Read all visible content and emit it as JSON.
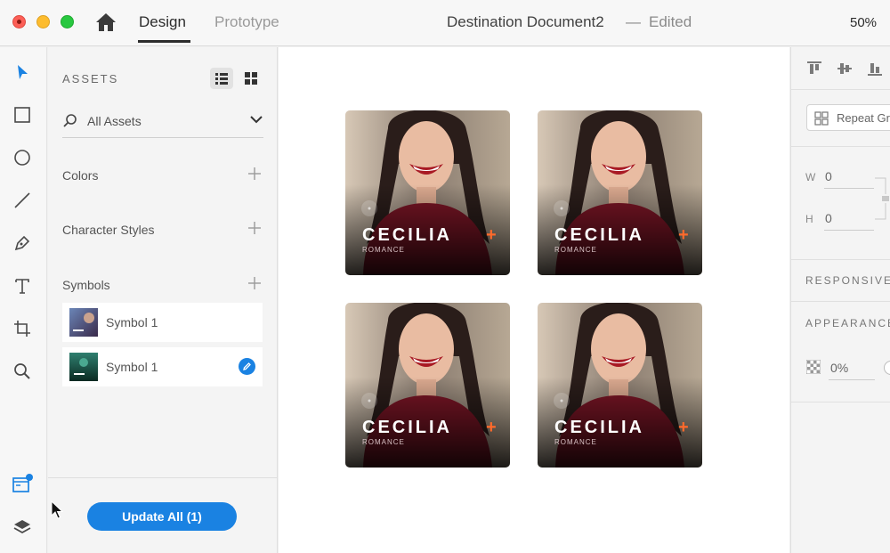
{
  "titlebar": {
    "tab_design": "Design",
    "tab_prototype": "Prototype",
    "document_title": "Destination Document2",
    "separator": "—",
    "document_status": "Edited",
    "zoom": "50%"
  },
  "assets": {
    "title": "ASSETS",
    "search_label": "All Assets",
    "colors_label": "Colors",
    "character_styles_label": "Character Styles",
    "symbols_label": "Symbols",
    "symbols": [
      {
        "label": "Symbol 1"
      },
      {
        "label": "Symbol 1"
      }
    ],
    "update_button": "Update All (1)"
  },
  "canvas": {
    "cards": [
      {
        "name": "CECILIA",
        "subtitle": "ROMANCE",
        "plus": "+"
      },
      {
        "name": "CECILIA",
        "subtitle": "ROMANCE",
        "plus": "+"
      },
      {
        "name": "CECILIA",
        "subtitle": "ROMANCE",
        "plus": "+"
      },
      {
        "name": "CECILIA",
        "subtitle": "ROMANCE",
        "plus": "+"
      }
    ]
  },
  "properties": {
    "repeat_grid": "Repeat Gr",
    "width_label": "W",
    "width_value": "0",
    "height_label": "H",
    "height_value": "0",
    "responsive_label": "RESPONSIVE",
    "appearance_label": "APPEARANCE",
    "opacity_value": "0%"
  },
  "colors": {
    "accent": "#1a82e2",
    "card_plus": "#ff6a2b",
    "card_shirt": "#7a1525"
  },
  "icons": [
    "home-icon",
    "select-arrow-icon",
    "rectangle-icon",
    "ellipse-icon",
    "line-icon",
    "pen-icon",
    "text-icon",
    "artboard-icon",
    "zoom-icon",
    "assets-icon",
    "layers-icon",
    "list-view-icon",
    "grid-view-icon",
    "search-icon",
    "chevron-down-icon",
    "plus-icon",
    "edit-pencil-icon",
    "align-top-icon",
    "align-middle-icon",
    "align-bottom-icon",
    "repeat-grid-icon",
    "lock-icon",
    "opacity-checker-icon"
  ]
}
